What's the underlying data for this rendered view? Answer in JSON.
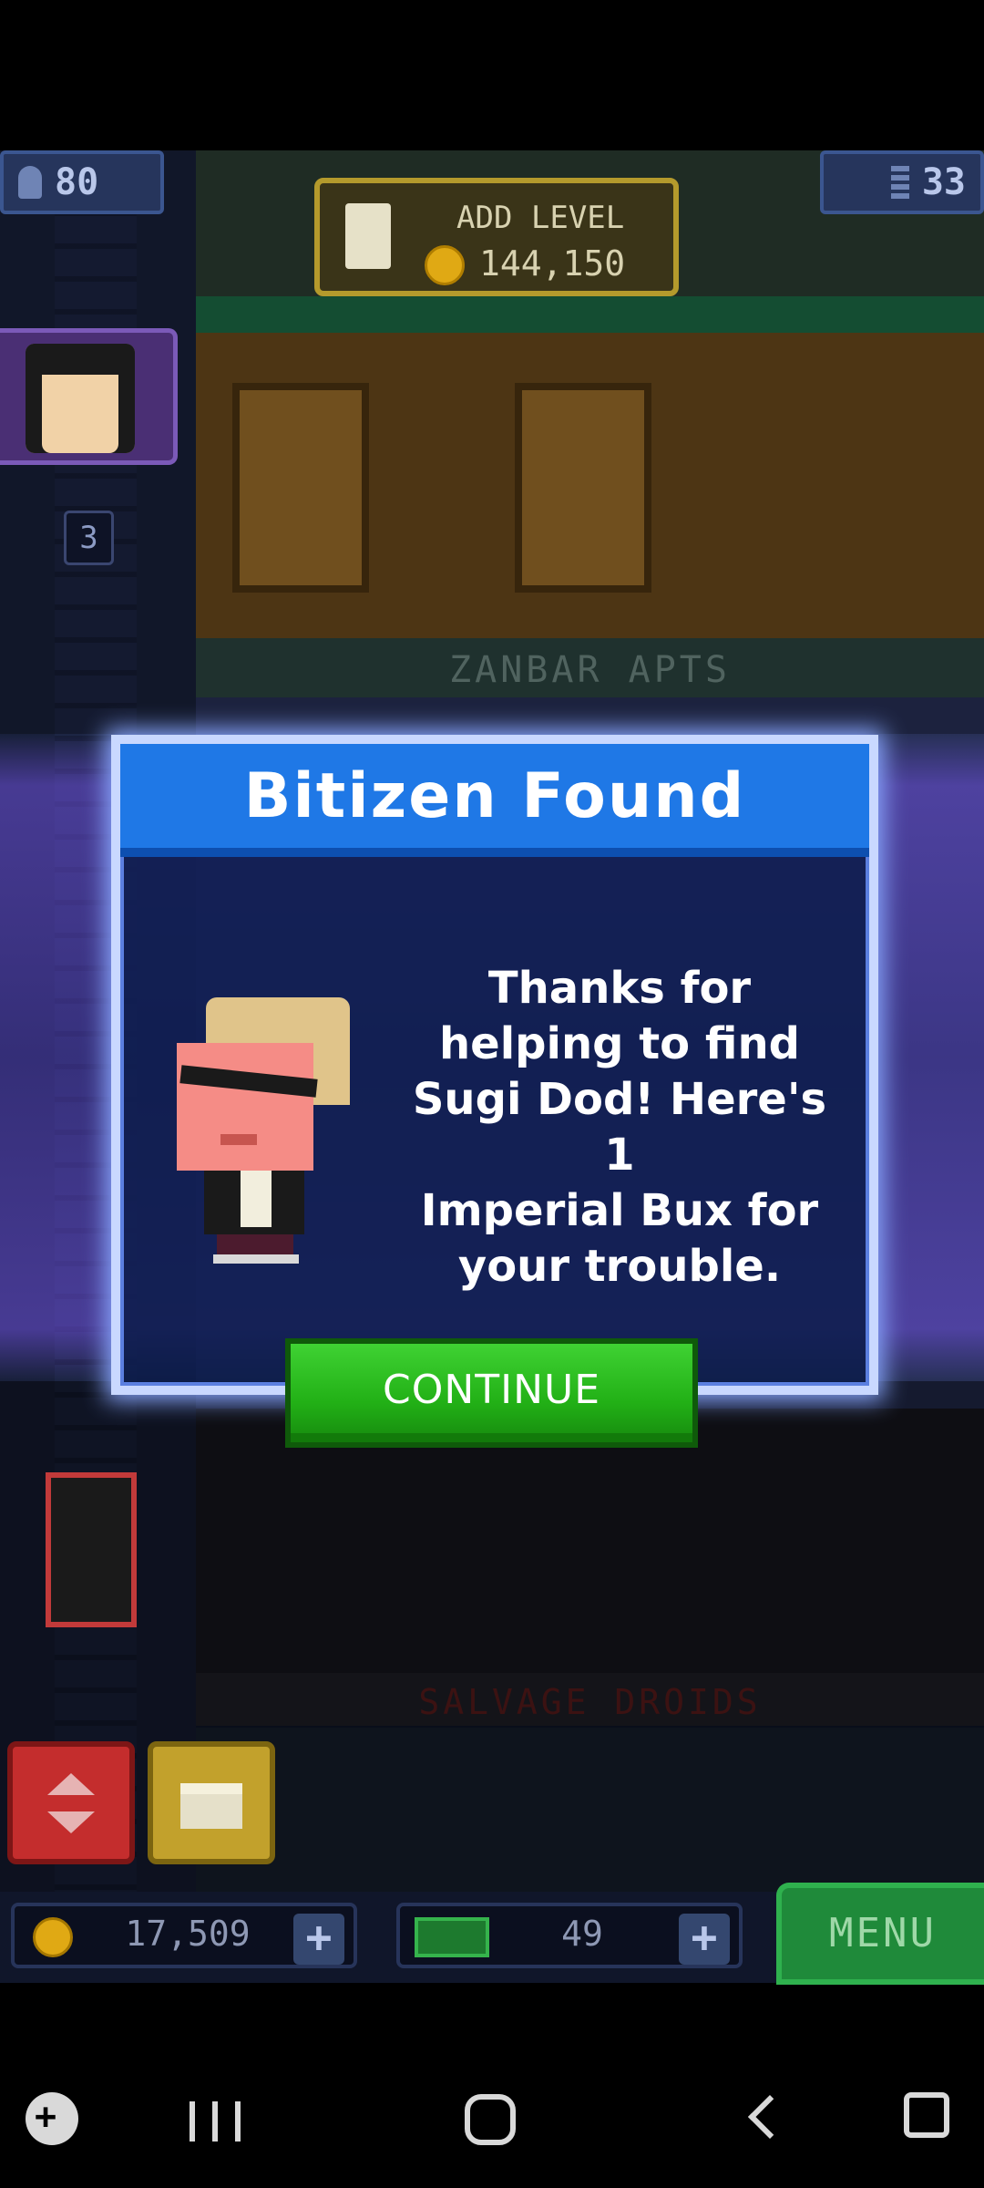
{
  "hud": {
    "population": "80",
    "floors": "33",
    "add_level_label": "ADD LEVEL",
    "add_level_cost": "144,150",
    "elevator_floor": "3",
    "coins": "17,509",
    "bux": "49",
    "plus": "+",
    "menu_label": "MENU"
  },
  "floors": {
    "zanbar": "ZANBAR APTS",
    "salvage": "SALVAGE DROIDS"
  },
  "dialog": {
    "title": "Bitizen Found",
    "message": "Thanks for\nhelping to find\nSugi Dod! Here's 1\nImperial Bux for\nyour trouble.",
    "continue_label": "CONTINUE"
  },
  "icons": {
    "population": "person-icon",
    "floors": "floors-icon",
    "coin": "coin-icon",
    "bux": "bux-icon",
    "add_level": "add-level-icon"
  },
  "colors": {
    "dialog_header": "#1f78e6",
    "continue_button": "#22b016",
    "menu_button": "#1f8a3a",
    "glow": "#6e50dc"
  }
}
